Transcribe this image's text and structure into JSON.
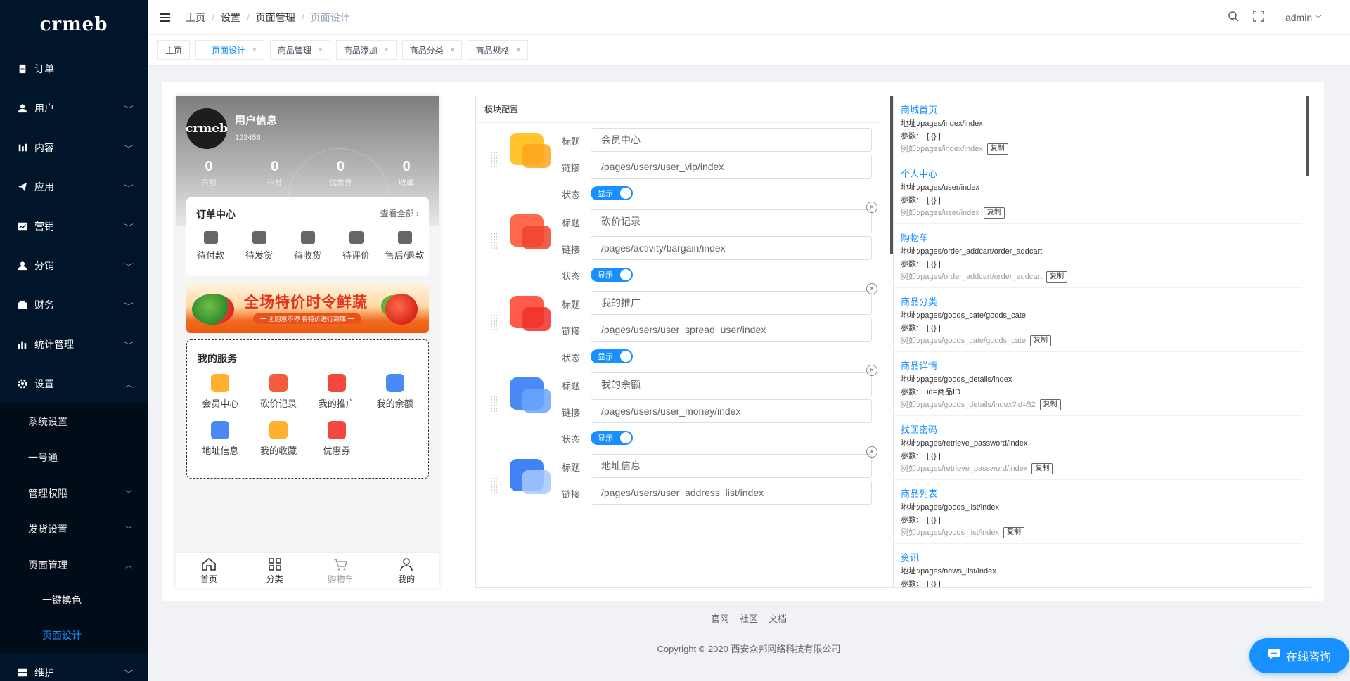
{
  "sidebar": {
    "logo": "crmeb",
    "items": [
      {
        "label": "订单",
        "icon": "document-icon"
      },
      {
        "label": "用户",
        "icon": "user-icon"
      },
      {
        "label": "内容",
        "icon": "chart-icon"
      },
      {
        "label": "应用",
        "icon": "send-icon"
      },
      {
        "label": "营销",
        "icon": "trend-icon"
      },
      {
        "label": "分销",
        "icon": "user-icon"
      },
      {
        "label": "财务",
        "icon": "wallet-icon"
      },
      {
        "label": "统计管理",
        "icon": "bar-chart-icon"
      },
      {
        "label": "设置",
        "icon": "gear-icon"
      }
    ],
    "settings_sub": [
      "系统设置",
      "一号通",
      "管理权限",
      "发货设置",
      "页面管理"
    ],
    "page_sub": [
      "一键换色",
      "页面设计"
    ],
    "last": "维护"
  },
  "breadcrumb": [
    "主页",
    "设置",
    "页面管理",
    "页面设计"
  ],
  "topright": {
    "user": "admin"
  },
  "tabs": [
    "主页",
    "页面设计",
    "商品管理",
    "商品添加",
    "商品分类",
    "商品规格"
  ],
  "phone": {
    "logo": "crmeb",
    "user_title": "用户信息",
    "user_id": "123456",
    "stats": [
      {
        "n": "0",
        "t": "余额"
      },
      {
        "n": "0",
        "t": "积分"
      },
      {
        "n": "0",
        "t": "优惠券"
      },
      {
        "n": "0",
        "t": "收藏"
      }
    ],
    "orders_title": "订单中心",
    "orders_more": "查看全部",
    "orders": [
      "待付款",
      "待发货",
      "待收货",
      "待评价",
      "售后/退款"
    ],
    "banner_title": "全场特价时令鲜蔬",
    "banner_sub": "一 团购意不停 将特价进行到底 一",
    "services_title": "我的服务",
    "services": [
      "会员中心",
      "砍价记录",
      "我的推广",
      "我的余额",
      "地址信息",
      "我的收藏",
      "优惠券"
    ],
    "tabbar": [
      "首页",
      "分类",
      "购物车",
      "我的"
    ]
  },
  "modules": {
    "title": "模块配置",
    "label_title": "标题",
    "label_link": "链接",
    "label_status": "状态",
    "switch_on": "显示",
    "items": [
      {
        "title": "会员中心",
        "link": "/pages/users/user_vip/index"
      },
      {
        "title": "砍价记录",
        "link": "/pages/activity/bargain/index"
      },
      {
        "title": "我的推广",
        "link": "/pages/users/user_spread_user/index"
      },
      {
        "title": "我的余额",
        "link": "/pages/users/user_money/index"
      },
      {
        "title": "地址信息",
        "link": "/pages/users/user_address_list/index"
      }
    ]
  },
  "links": {
    "addr_label": "地址:",
    "param_label": "参数:",
    "example_label": "例如:",
    "copy": "复制",
    "items": [
      {
        "name": "商城首页",
        "addr": "/pages/index/index",
        "param": "[ {} ]",
        "example": "/pages/index/index"
      },
      {
        "name": "个人中心",
        "addr": "/pages/user/index",
        "param": "[ {} ]",
        "example": "/pages/user/index"
      },
      {
        "name": "购物车",
        "addr": "/pages/order_addcart/order_addcart",
        "param": "[ {} ]",
        "example": "/pages/order_addcart/order_addcart"
      },
      {
        "name": "商品分类",
        "addr": "/pages/goods_cate/goods_cate",
        "param": "[ {} ]",
        "example": "/pages/goods_cate/goods_cate"
      },
      {
        "name": "商品详情",
        "addr": "/pages/goods_details/index",
        "param": "id=商品ID",
        "example": "/pages/goods_details/index?id=52"
      },
      {
        "name": "找回密码",
        "addr": "/pages/retrieve_password/index",
        "param": "[ {} ]",
        "example": "/pages/retrieve_password/index"
      },
      {
        "name": "商品列表",
        "addr": "/pages/goods_list/index",
        "param": "[ {} ]",
        "example": "/pages/goods_list/index"
      },
      {
        "name": "资讯",
        "addr": "/pages/news_list/index",
        "param": "[ {} ]",
        "example": ""
      }
    ]
  },
  "footer": {
    "links": [
      "官网",
      "社区",
      "文档"
    ],
    "copyright": "Copyright © 2020 西安众邦网络科技有限公司"
  },
  "chat": "在线咨询",
  "colors": {
    "sidebar_bg": "#001529",
    "accent": "#1890ff"
  }
}
